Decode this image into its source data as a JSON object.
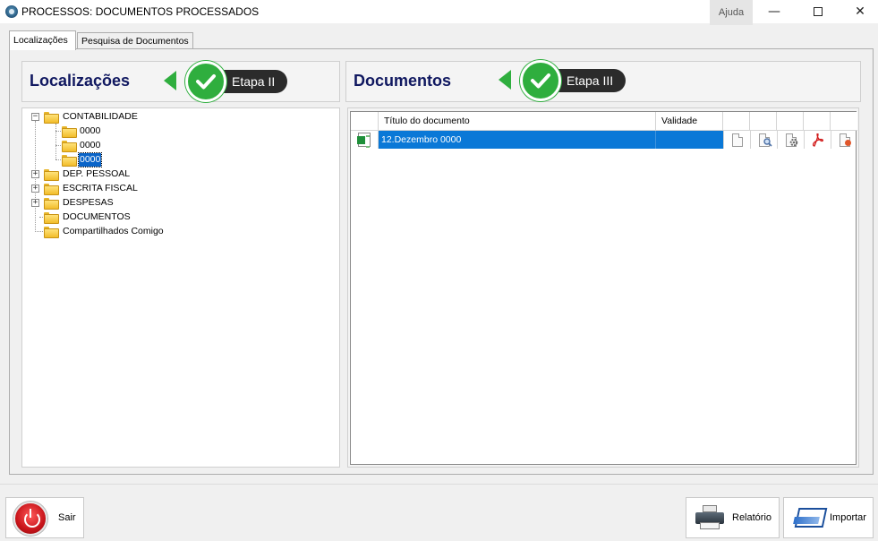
{
  "window": {
    "title": "PROCESSOS: DOCUMENTOS PROCESSADOS",
    "help_label": "Ajuda",
    "minimize_glyph": "—",
    "close_glyph": "✕"
  },
  "tabs": [
    {
      "label": "Localizações",
      "active": true
    },
    {
      "label": "Pesquisa de Documentos",
      "active": false
    }
  ],
  "left_panel": {
    "header": "Localizações",
    "step_label": "Etapa II"
  },
  "right_panel": {
    "header": "Documentos",
    "step_label": "Etapa III"
  },
  "tree": {
    "nodes": [
      {
        "label": "CONTABILIDADE",
        "expanded": true
      },
      {
        "label": "0000"
      },
      {
        "label": "0000"
      },
      {
        "label": "0000",
        "selected": true
      },
      {
        "label": "DEP. PESSOAL",
        "expanded": false
      },
      {
        "label": "ESCRITA FISCAL",
        "expanded": false
      },
      {
        "label": "DESPESAS",
        "expanded": false
      },
      {
        "label": "DOCUMENTOS"
      },
      {
        "label": "Compartilhados Comigo"
      }
    ]
  },
  "grid": {
    "columns": [
      "",
      "Título do documento",
      "Validade",
      "",
      "",
      "",
      "",
      ""
    ],
    "rows": [
      {
        "icon": "excel-file-icon",
        "title": "12.Dezembro 0000",
        "validity": ""
      }
    ],
    "row_action_icons": [
      "new-document-icon",
      "preview-document-icon",
      "settings-document-icon",
      "pdf-icon",
      "delete-document-icon"
    ]
  },
  "buttons": {
    "exit": "Sair",
    "report": "Relatório",
    "import": "Importar"
  },
  "colors": {
    "header_text": "#101860",
    "step_green": "#2fae3e",
    "step_dark": "#2b2b2b",
    "selection_blue": "#0a78d7"
  }
}
